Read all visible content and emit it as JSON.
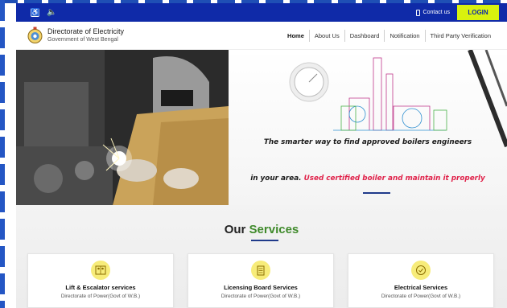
{
  "topbar": {
    "accessibility_icon": "wheelchair-icon",
    "audio_icon": "speaker-icon",
    "contact_label": "Contact us",
    "login_label": "LOGIN",
    "colors": {
      "bar": "#0f2aa8",
      "login_bg": "#d9f20e"
    }
  },
  "header": {
    "logo_icon": "state-emblem-icon",
    "title": "Directorate of Electricity",
    "subtitle": "Government of West Bengal"
  },
  "nav": {
    "items": [
      {
        "label": "Home"
      },
      {
        "label": "About Us"
      },
      {
        "label": "Dashboard"
      },
      {
        "label": "Notification"
      },
      {
        "label": "Third Party Verification"
      }
    ]
  },
  "hero": {
    "line1": "The smarter way to find approved boilers engineers",
    "line2_a": "in your area. ",
    "line2_b": "Used certified boiler and maintain it properly",
    "highlight_color": "#e0224a"
  },
  "services": {
    "title_a": "Our ",
    "title_b": "Services",
    "title_accent": "#3f8a2b",
    "cards": [
      {
        "icon": "elevator-icon",
        "title": "Lift & Escalator services",
        "subtitle": "Directorate of Power(Govt of W.B.)"
      },
      {
        "icon": "document-icon",
        "title": "Licensing Board Services",
        "subtitle": "Directorate of Power(Govt of W.B.)"
      },
      {
        "icon": "badge-check-icon",
        "title": "Electrical Services",
        "subtitle": "Directorate of Power(Govt of W.B.)"
      }
    ]
  }
}
